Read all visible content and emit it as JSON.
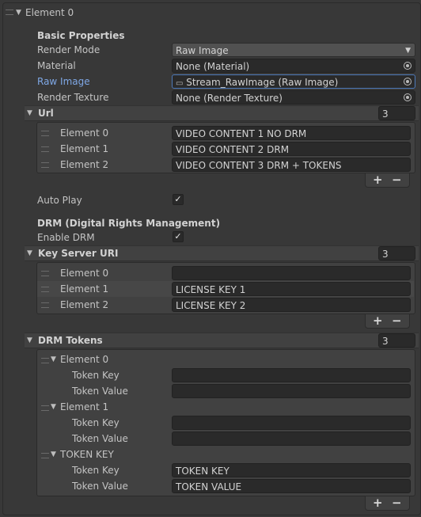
{
  "element_title": "Element 0",
  "basic": {
    "heading": "Basic Properties",
    "render_mode_label": "Render Mode",
    "render_mode_value": "Raw Image",
    "material_label": "Material",
    "material_value": "None (Material)",
    "raw_image_label": "Raw Image",
    "raw_image_value": "Stream_RawImage (Raw Image)",
    "render_texture_label": "Render Texture",
    "render_texture_value": "None (Render Texture)"
  },
  "url": {
    "label": "Url",
    "count": "3",
    "items": [
      {
        "label": "Element 0",
        "value": "VIDEO CONTENT 1 NO DRM"
      },
      {
        "label": "Element 1",
        "value": "VIDEO CONTENT 2 DRM"
      },
      {
        "label": "Element 2",
        "value": "VIDEO CONTENT 3 DRM + TOKENS"
      }
    ]
  },
  "auto_play": {
    "label": "Auto Play",
    "checked": true
  },
  "drm": {
    "heading": "DRM (Digital Rights Management)",
    "enable_label": "Enable DRM",
    "enabled": true
  },
  "key_server": {
    "label": "Key Server URI",
    "count": "3",
    "items": [
      {
        "label": "Element 0",
        "value": ""
      },
      {
        "label": "Element 1",
        "value": "LICENSE KEY 1"
      },
      {
        "label": "Element 2",
        "value": "LICENSE KEY 2"
      }
    ]
  },
  "drm_tokens": {
    "label": "DRM Tokens",
    "count": "3",
    "items": [
      {
        "label": "Element 0",
        "key_label": "Token Key",
        "key_value": "",
        "value_label": "Token Value",
        "value_value": ""
      },
      {
        "label": "Element 1",
        "key_label": "Token Key",
        "key_value": "",
        "value_label": "Token Value",
        "value_value": ""
      },
      {
        "label": "TOKEN KEY",
        "key_label": "Token Key",
        "key_value": "TOKEN KEY",
        "value_label": "Token Value",
        "value_value": "TOKEN VALUE"
      }
    ]
  },
  "buttons": {
    "add": "+",
    "remove": "−"
  },
  "icons": {
    "check": "✓",
    "foldout": "▼",
    "chevron": "▼",
    "texture": "▭"
  },
  "colors": {
    "background": "#383838",
    "field": "#2a2a2a",
    "header": "#414141",
    "accent": "#7fa8e6",
    "selected_border": "#4d79b8"
  }
}
